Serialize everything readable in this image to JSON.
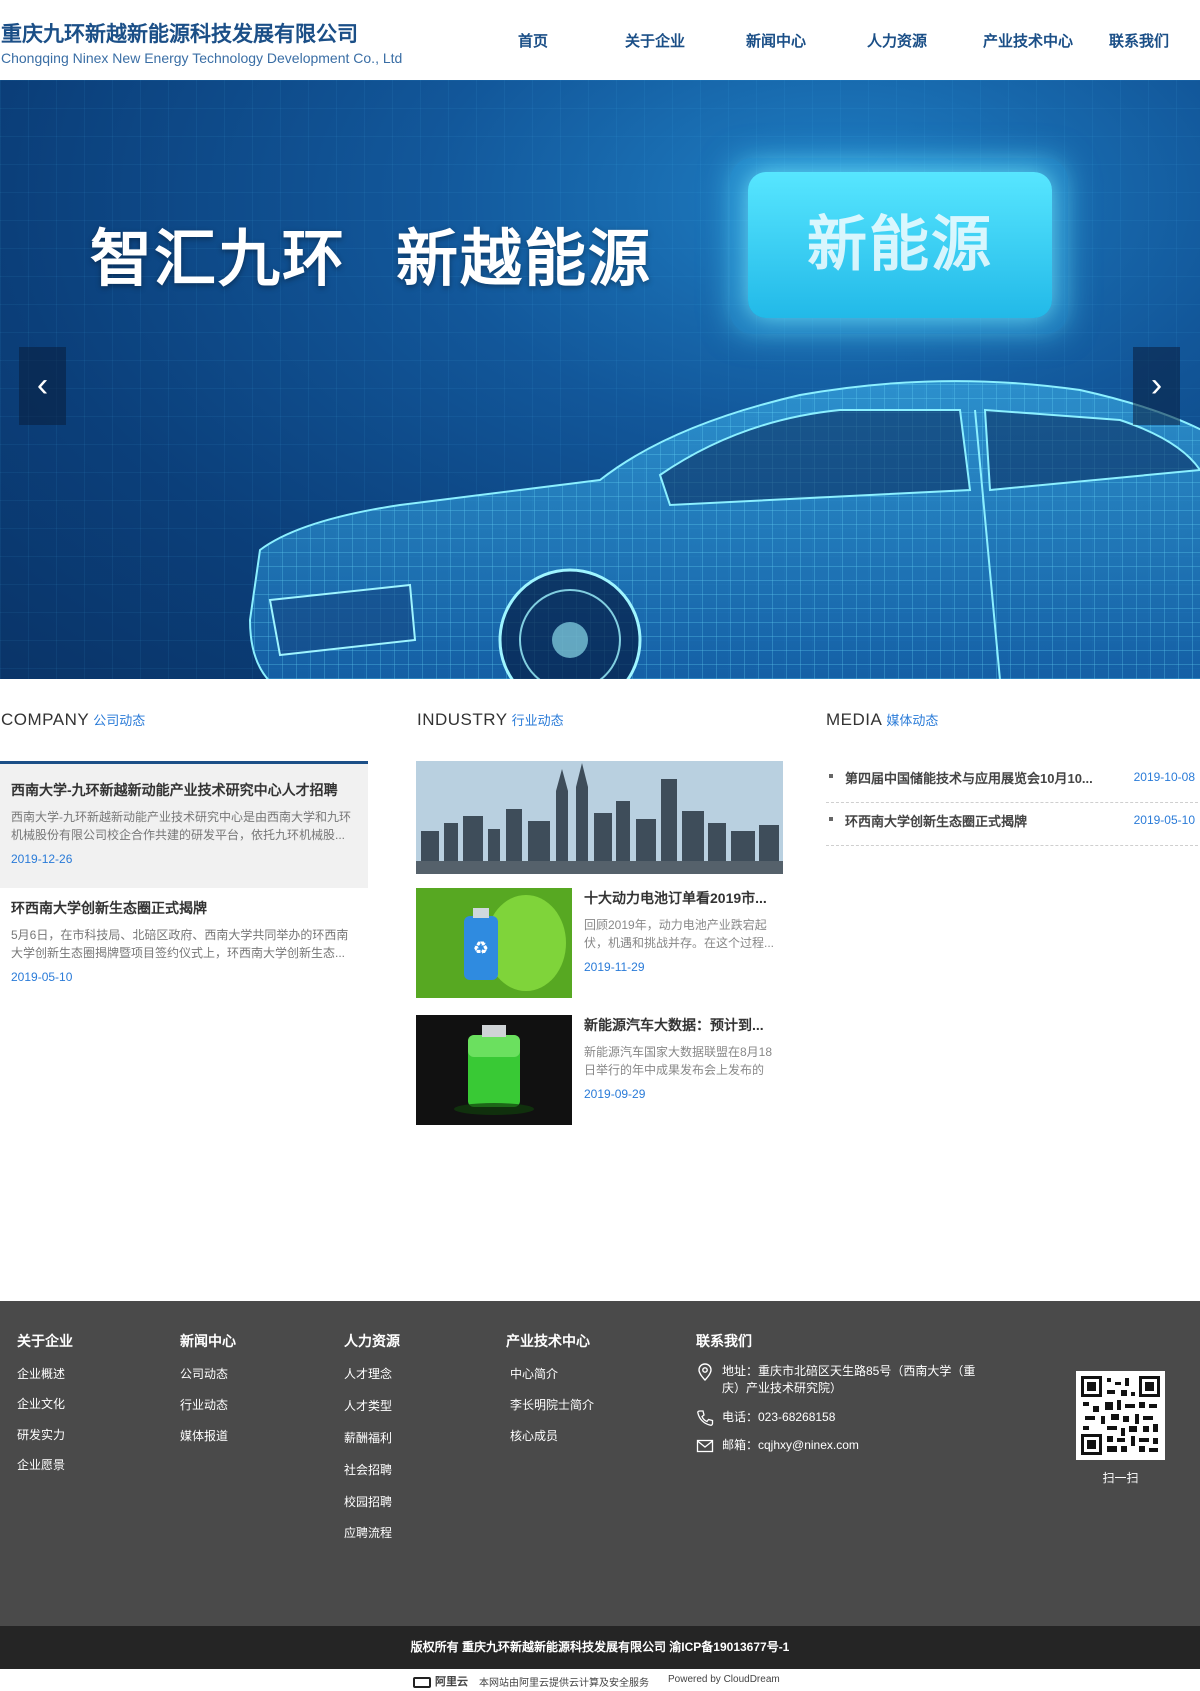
{
  "header": {
    "company_cn": "重庆九环新越新能源科技发展有限公司",
    "company_en": "Chongqing Ninex New Energy Technology Development Co., Ltd",
    "nav": [
      "首页",
      "关于企业",
      "新闻中心",
      "人力资源",
      "产业技术中心",
      "联系我们"
    ]
  },
  "banner": {
    "slogan_1": "智汇九环",
    "slogan_2": "新越能源",
    "badge_text": "新能源",
    "prev_icon": "‹",
    "next_icon": "›"
  },
  "company": {
    "title_en": "COMPANY",
    "title_cn": "公司动态",
    "items": [
      {
        "title": "西南大学-九环新越新动能产业技术研究中心人才招聘",
        "desc": "西南大学-九环新越新动能产业技术研究中心是由西南大学和九环机械股份有限公司校企合作共建的研发平台，依托九环机械股...",
        "date": "2019-12-26"
      },
      {
        "title": "环西南大学创新生态圈正式揭牌",
        "desc": "5月6日，在市科技局、北碚区政府、西南大学共同举办的环西南大学创新生态圈揭牌暨项目签约仪式上，环西南大学创新生态...",
        "date": "2019-05-10"
      }
    ]
  },
  "industry": {
    "title_en": "INDUSTRY",
    "title_cn": "行业动态",
    "items": [
      {
        "title": "十大动力电池订单看2019市...",
        "desc": "回顾2019年，动力电池产业跌宕起伏，机遇和挑战并存。在这个过程...",
        "date": "2019-11-29"
      },
      {
        "title": "新能源汽车大数据：预计到...",
        "desc": "新能源汽车国家大数据联盟在8月18日举行的年中成果发布会上发布的《...",
        "date": "2019-09-29"
      }
    ]
  },
  "media": {
    "title_en": "MEDIA",
    "title_cn": "媒体动态",
    "items": [
      {
        "title": "第四届中国储能技术与应用展览会10月10...",
        "date": "2019-10-08"
      },
      {
        "title": "环西南大学创新生态圈正式揭牌",
        "date": "2019-05-10"
      }
    ]
  },
  "footer": {
    "col_about": {
      "heading": "关于企业",
      "links": [
        "企业概述",
        "企业文化",
        "研发实力",
        "企业愿景"
      ]
    },
    "col_news": {
      "heading": "新闻中心",
      "links": [
        "公司动态",
        "行业动态",
        "媒体报道"
      ]
    },
    "col_hr": {
      "heading": "人力资源",
      "links": [
        "人才理念",
        "人才类型",
        "薪酬福利",
        "社会招聘",
        "校园招聘",
        "应聘流程"
      ]
    },
    "col_tech": {
      "heading": "产业技术中心",
      "links": [
        "中心简介",
        "李长明院士简介",
        "核心成员"
      ]
    },
    "contact": {
      "heading": "联系我们",
      "address": "地址：重庆市北碚区天生路85号（西南大学（重庆）产业技术研究院）",
      "phone": "电话：023-68268158",
      "email": "邮箱：cqjhxy@ninex.com"
    },
    "qr_caption": "扫一扫",
    "copyright": "版权所有 重庆九环新越新能源科技发展有限公司     渝ICP备19013677号-1",
    "aliyun_logo": "阿里云",
    "aliyun_note": "本网站由阿里云提供云计算及安全服务",
    "powered_by": "Powered by CloudDream"
  }
}
